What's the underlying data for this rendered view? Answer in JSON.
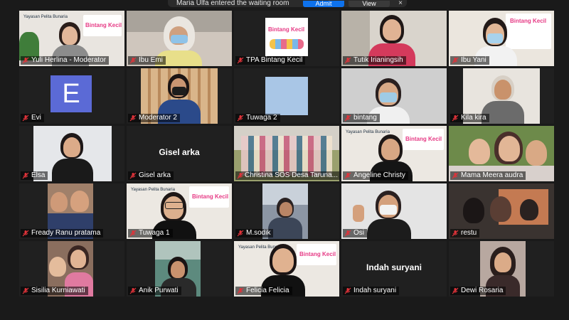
{
  "notification": {
    "message": "Maria Ulfa entered the waiting room",
    "admit_label": "Admit",
    "view_label": "View",
    "close_label": "×"
  },
  "banner_text": {
    "brand": "Bintang Kecil",
    "foundation": "Yayasan Pelita Bunaria"
  },
  "participants": [
    {
      "name": "Yuli Herlina - Moderator"
    },
    {
      "name": "Ibu Emi"
    },
    {
      "name": "TPA Bintang Kecil"
    },
    {
      "name": "Tutik Irianingsih"
    },
    {
      "name": "Ibu Yani"
    },
    {
      "name": "Evi",
      "avatar_letter": "E"
    },
    {
      "name": "Moderator 2"
    },
    {
      "name": "Tuwaga 2"
    },
    {
      "name": "bintang"
    },
    {
      "name": "Kila kira"
    },
    {
      "name": "Elsa"
    },
    {
      "name": "Gisel arka",
      "center_text": "Gisel arka"
    },
    {
      "name": "Christina SOS Desa Taruna..."
    },
    {
      "name": "Angeline Christy"
    },
    {
      "name": "Mama Meera audra"
    },
    {
      "name": "Fready Ranu pratama"
    },
    {
      "name": "Tuwaga 1"
    },
    {
      "name": "M.sodik"
    },
    {
      "name": "Osi"
    },
    {
      "name": "restu"
    },
    {
      "name": "Sisilia Kurniawati"
    },
    {
      "name": "Anik Purwati"
    },
    {
      "name": "Felicia Felicia"
    },
    {
      "name": "Indah suryani",
      "center_text": "Indah suryani"
    },
    {
      "name": "Dewi Rosaria"
    }
  ]
}
